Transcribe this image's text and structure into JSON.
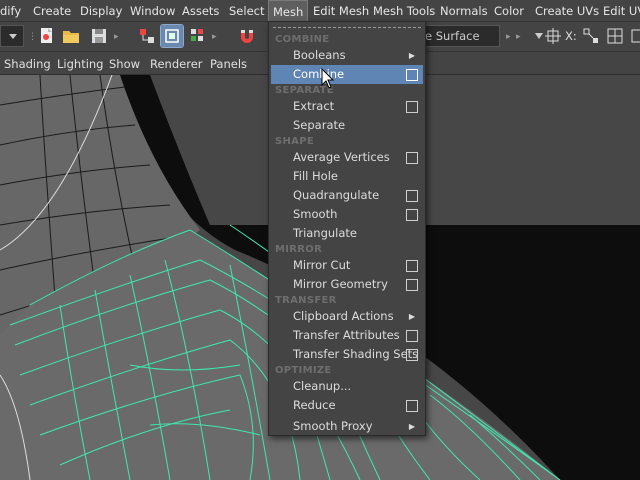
{
  "menubar": {
    "items": [
      {
        "label": "dify"
      },
      {
        "label": "Create"
      },
      {
        "label": "Display"
      },
      {
        "label": "Window"
      },
      {
        "label": "Assets"
      },
      {
        "label": "Select"
      },
      {
        "label": "Mesh",
        "active": true
      },
      {
        "label": "Edit Mesh"
      },
      {
        "label": "Mesh Tools"
      },
      {
        "label": "Normals"
      },
      {
        "label": "Color"
      },
      {
        "label": "Create UVs"
      },
      {
        "label": "Edit UV"
      }
    ]
  },
  "toolbar": {
    "live_surface_text": "e Surface",
    "x_label": "X:"
  },
  "panel_menu": {
    "items": [
      "Shading",
      "Lighting",
      "Show",
      "Renderer",
      "Panels"
    ]
  },
  "mesh_menu": {
    "sections": {
      "combine": "COMBINE",
      "separate": "SEPARATE",
      "shape": "SHAPE",
      "mirror": "MIRROR",
      "transfer": "TRANSFER",
      "optimize": "OPTIMIZE"
    },
    "items": {
      "booleans": "Booleans",
      "combine": "Combine",
      "extract": "Extract",
      "separate": "Separate",
      "average_vertices": "Average Vertices",
      "fill_hole": "Fill Hole",
      "quadrangulate": "Quadrangulate",
      "smooth": "Smooth",
      "triangulate": "Triangulate",
      "mirror_cut": "Mirror Cut",
      "mirror_geometry": "Mirror Geometry",
      "clipboard_actions": "Clipboard Actions",
      "transfer_attributes": "Transfer Attributes",
      "transfer_shading_sets": "Transfer Shading Sets",
      "cleanup": "Cleanup...",
      "reduce": "Reduce",
      "smooth_proxy": "Smooth Proxy"
    },
    "highlighted": "Combine"
  },
  "colors": {
    "highlight": "#5f85b5",
    "wire_selected": "#3ee8b0",
    "wire_default": "#1a1a1a",
    "ui_background": "#444444"
  }
}
